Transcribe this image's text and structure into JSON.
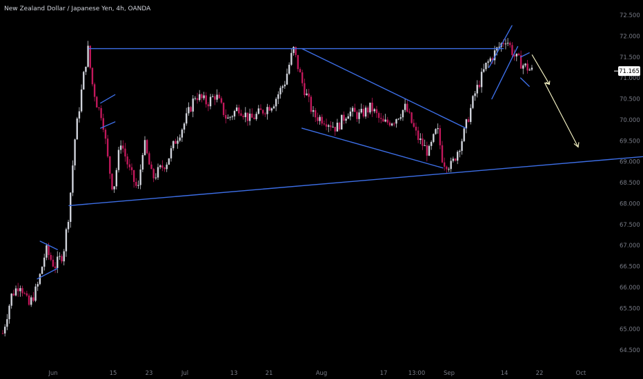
{
  "header": {
    "symbol_title": "New Zealand Dollar / Japanese Yen, 4h, OANDA"
  },
  "chart_data": {
    "type": "candlestick",
    "title": "New Zealand Dollar / Japanese Yen, 4h, OANDA",
    "ylim": [
      64.4,
      72.7
    ],
    "grid": false,
    "y_ticks": [
      "72.500",
      "72.000",
      "71.500",
      "71.000",
      "70.500",
      "70.000",
      "69.500",
      "69.000",
      "68.500",
      "68.000",
      "67.500",
      "67.000",
      "66.500",
      "66.000",
      "65.500",
      "65.000",
      "64.500"
    ],
    "x_ticks": [
      "Jun",
      "15",
      "23",
      "Jul",
      "13",
      "21",
      "Aug",
      "17",
      "13:00",
      "Sep",
      "14",
      "22",
      "Oct"
    ],
    "last_price": {
      "label": "71.165",
      "value": 71.165
    },
    "colors": {
      "up": "#d1d4dc",
      "down": "#c2185b",
      "trendline": "#3d6fe8",
      "projection": "#f0eec0",
      "axis_text": "#787b86",
      "price_tag_bg": "#ffffff",
      "price_tag_text": "#000000"
    },
    "price_path": [
      {
        "d": 0,
        "p": 64.9
      },
      {
        "d": 1.5,
        "p": 65.8
      },
      {
        "d": 3,
        "p": 66.1
      },
      {
        "d": 4.5,
        "p": 65.55
      },
      {
        "d": 6,
        "p": 66.0
      },
      {
        "d": 7.5,
        "p": 66.9
      },
      {
        "d": 9,
        "p": 66.5
      },
      {
        "d": 10.5,
        "p": 66.8
      },
      {
        "d": 11.5,
        "p": 67.8
      },
      {
        "d": 12.5,
        "p": 69.5
      },
      {
        "d": 14,
        "p": 71.0
      },
      {
        "d": 14.8,
        "p": 71.7
      },
      {
        "d": 15.5,
        "p": 70.9
      },
      {
        "d": 16.5,
        "p": 70.3
      },
      {
        "d": 17.3,
        "p": 70.1
      },
      {
        "d": 18.3,
        "p": 69.0
      },
      {
        "d": 19.2,
        "p": 68.3
      },
      {
        "d": 20.5,
        "p": 69.5
      },
      {
        "d": 22.0,
        "p": 68.8
      },
      {
        "d": 23.5,
        "p": 68.3
      },
      {
        "d": 24.5,
        "p": 69.5
      },
      {
        "d": 26.0,
        "p": 68.6
      },
      {
        "d": 28.5,
        "p": 69.0
      },
      {
        "d": 30,
        "p": 69.5
      },
      {
        "d": 31.5,
        "p": 69.9
      },
      {
        "d": 33.5,
        "p": 70.6
      },
      {
        "d": 35.5,
        "p": 70.4
      },
      {
        "d": 37,
        "p": 70.6
      },
      {
        "d": 39,
        "p": 70.0
      },
      {
        "d": 41,
        "p": 70.3
      },
      {
        "d": 43,
        "p": 70.0
      },
      {
        "d": 45,
        "p": 70.2
      },
      {
        "d": 47,
        "p": 70.4
      },
      {
        "d": 49,
        "p": 70.9
      },
      {
        "d": 50.5,
        "p": 71.7
      },
      {
        "d": 52,
        "p": 70.9
      },
      {
        "d": 54,
        "p": 70.1
      },
      {
        "d": 56,
        "p": 70.0
      },
      {
        "d": 58,
        "p": 69.8
      },
      {
        "d": 60,
        "p": 70.2
      },
      {
        "d": 62,
        "p": 70.1
      },
      {
        "d": 64,
        "p": 70.3
      },
      {
        "d": 66,
        "p": 69.9
      },
      {
        "d": 68,
        "p": 70.0
      },
      {
        "d": 70,
        "p": 70.3
      },
      {
        "d": 72,
        "p": 69.6
      },
      {
        "d": 74,
        "p": 69.2
      },
      {
        "d": 75.5,
        "p": 69.8
      },
      {
        "d": 76.5,
        "p": 69.0
      },
      {
        "d": 78,
        "p": 68.9
      },
      {
        "d": 80,
        "p": 69.6
      },
      {
        "d": 82,
        "p": 70.6
      },
      {
        "d": 84,
        "p": 71.3
      },
      {
        "d": 86,
        "p": 71.7
      },
      {
        "d": 87.5,
        "p": 71.95
      },
      {
        "d": 89,
        "p": 71.5
      },
      {
        "d": 90.5,
        "p": 71.3
      },
      {
        "d": 92,
        "p": 71.165
      }
    ],
    "drawings": {
      "horizontal_resistance": [
        {
          "d": 15,
          "p": 71.7
        },
        {
          "d": 87,
          "p": 71.7
        }
      ],
      "rising_support": [
        {
          "d": 11.5,
          "p": 67.95
        },
        {
          "d": 118,
          "p": 69.2
        }
      ],
      "channel_upper": [
        {
          "d": 52,
          "p": 71.7
        },
        {
          "d": 80.5,
          "p": 69.8
        }
      ],
      "channel_lower": [
        {
          "d": 52,
          "p": 69.8
        },
        {
          "d": 76.5,
          "p": 68.85
        }
      ],
      "flag1_top": [
        {
          "d": 6.5,
          "p": 67.1
        },
        {
          "d": 9.5,
          "p": 66.9
        }
      ],
      "flag1_bottom": [
        {
          "d": 6.0,
          "p": 66.2
        },
        {
          "d": 9.5,
          "p": 66.45
        }
      ],
      "flag2_top": [
        {
          "d": 17.0,
          "p": 70.4
        },
        {
          "d": 19.5,
          "p": 70.6
        }
      ],
      "flag2_bottom": [
        {
          "d": 17.0,
          "p": 69.8
        },
        {
          "d": 19.5,
          "p": 69.95
        }
      ],
      "spike_upper": [
        {
          "d": 84.5,
          "p": 71.25
        },
        {
          "d": 88.5,
          "p": 72.25
        }
      ],
      "spike_lower": [
        {
          "d": 85.0,
          "p": 70.5
        },
        {
          "d": 89.5,
          "p": 71.75
        }
      ],
      "pullback_top": [
        {
          "d": 90,
          "p": 71.5
        },
        {
          "d": 91.5,
          "p": 71.6
        }
      ],
      "pullback_bottom": [
        {
          "d": 90,
          "p": 71.0
        },
        {
          "d": 91.5,
          "p": 70.8
        }
      ],
      "projection": [
        {
          "d": 92,
          "p": 71.55
        },
        {
          "d": 95,
          "p": 70.85
        },
        {
          "d": 94.2,
          "p": 70.88
        },
        {
          "d": 100,
          "p": 69.35
        }
      ]
    }
  }
}
